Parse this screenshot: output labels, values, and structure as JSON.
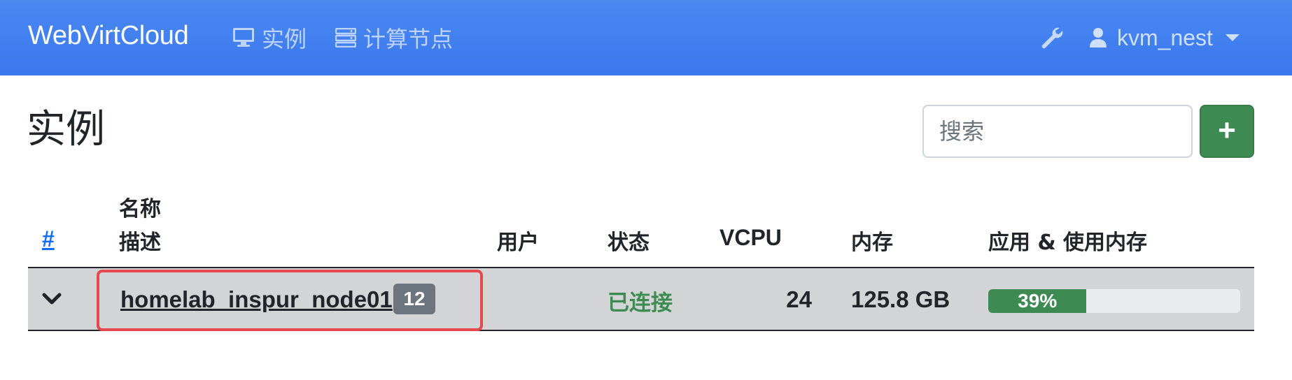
{
  "navbar": {
    "brand": "WebVirtCloud",
    "items": [
      {
        "label": "实例",
        "icon": "monitor-icon"
      },
      {
        "label": "计算节点",
        "icon": "server-icon"
      }
    ],
    "user": {
      "name": "kvm_nest",
      "icon": "user-icon"
    },
    "settings_icon": "wrench-icon"
  },
  "page": {
    "title": "实例",
    "search": {
      "placeholder": "搜索",
      "value": ""
    },
    "add_label": "+"
  },
  "table": {
    "headers": {
      "hash": "#",
      "name": "名称",
      "description": "描述",
      "user": "用户",
      "status": "状态",
      "vcpu": "VCPU",
      "memory": "内存",
      "usage": "应用 & 使用内存"
    },
    "rows": [
      {
        "host": "homelab_inspur_node01",
        "instance_count": "12",
        "user": "",
        "status": "已连接",
        "vcpu": "24",
        "memory": "125.8 GB",
        "usage_percent": 39,
        "usage_label": "39%"
      }
    ]
  },
  "colors": {
    "navbar": "#3a78ee",
    "success": "#3d8b52",
    "highlight": "#e5484d",
    "badge": "#6c757d",
    "row_bg": "#d3d4d6"
  }
}
